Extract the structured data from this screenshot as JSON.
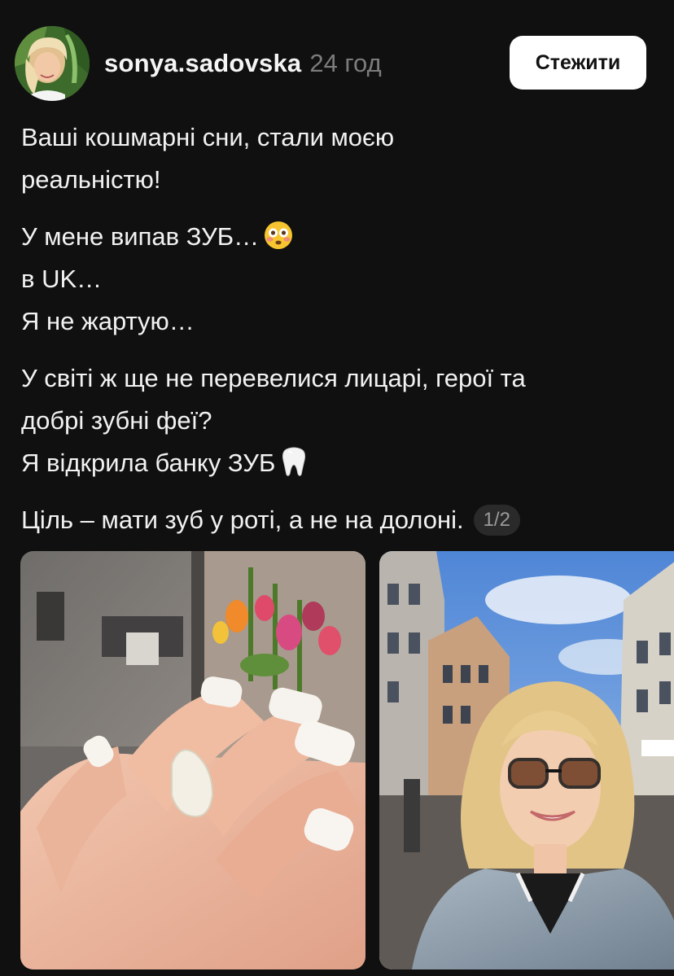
{
  "post": {
    "author": {
      "username": "sonya.sadovska",
      "timestamp": "24 год"
    },
    "follow_label": "Стежити",
    "paragraphs": [
      [
        "Ваші кошмарні сни, стали моєю",
        "реальністю!"
      ],
      [
        "У мене випав ЗУБ…",
        "в UK…",
        "Я не жартую…"
      ],
      [
        "У світі ж ще не перевелися лицарі, герої та",
        "добрі зубні феї?",
        "Я відкрила банку ЗУБ"
      ],
      [
        "Ціль – мати зуб у роті, а не на долоні."
      ]
    ],
    "emojis": {
      "line_2_1": "flushed-face-icon",
      "line_3_3": "tooth-icon"
    },
    "media_counter": "1/2",
    "media": [
      {
        "name": "photo-tooth-in-hand"
      },
      {
        "name": "photo-selfie-street"
      }
    ]
  },
  "colors": {
    "background": "#101010",
    "text": "#f2f2f2",
    "muted": "#7c7c7c",
    "button_bg": "#ffffff",
    "button_text": "#111111"
  }
}
